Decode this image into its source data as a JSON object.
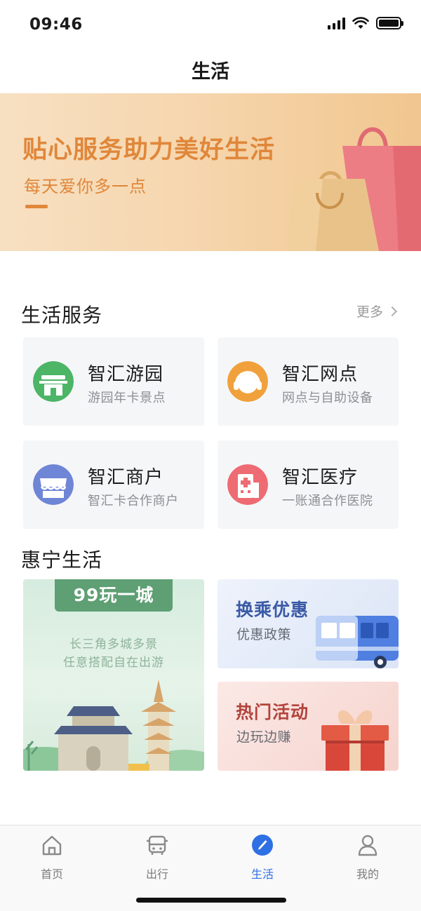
{
  "status_bar": {
    "time": "09:46",
    "icons": [
      "signal-icon",
      "wifi-icon",
      "battery-icon"
    ]
  },
  "nav": {
    "title": "生活"
  },
  "banner": {
    "title": "贴心服务助力美好生活",
    "subtitle": "每天爱你多一点"
  },
  "life_services": {
    "title": "生活服务",
    "more_label": "更多",
    "items": [
      {
        "name": "智汇游园",
        "desc": "游园年卡景点",
        "icon": "park-gate-icon",
        "color": "#4cb566"
      },
      {
        "name": "智汇网点",
        "desc": "网点与自助设备",
        "icon": "headset-icon",
        "color": "#f0a13c"
      },
      {
        "name": "智汇商户",
        "desc": "智汇卡合作商户",
        "icon": "shop-awning-icon",
        "color": "#6f86d6"
      },
      {
        "name": "智汇医疗",
        "desc": "一账通合作医院",
        "icon": "hospital-icon",
        "color": "#ee6b73"
      }
    ]
  },
  "huining": {
    "title": "惠宁生活",
    "feature": {
      "tag": "99玩一城",
      "line1": "长三角多城多景",
      "line2": "任意搭配自在出游"
    },
    "promos": [
      {
        "title": "换乘优惠",
        "subtitle": "优惠政策",
        "title_color": "#3a5aa6"
      },
      {
        "title": "热门活动",
        "subtitle": "边玩边赚",
        "title_color": "#b2443c"
      }
    ]
  },
  "tab_bar": {
    "tabs": [
      {
        "label": "首页",
        "icon": "home-icon",
        "active": false
      },
      {
        "label": "出行",
        "icon": "bus-icon",
        "active": false
      },
      {
        "label": "生活",
        "icon": "compass-icon",
        "active": true
      },
      {
        "label": "我的",
        "icon": "user-icon",
        "active": false
      }
    ]
  },
  "colors": {
    "accent": "#2f6fe4",
    "banner_text": "#e0873a",
    "card_bg": "#f5f6f8"
  }
}
